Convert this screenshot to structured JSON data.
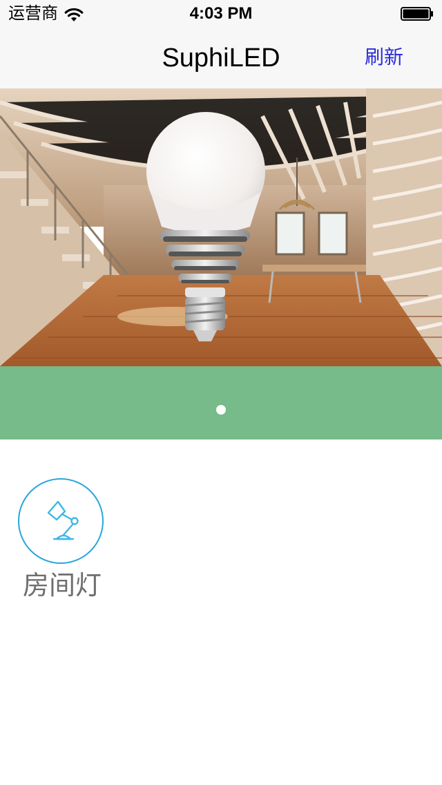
{
  "status_bar": {
    "carrier": "运营商",
    "time": "4:03 PM",
    "wifi_icon": "wifi-icon",
    "battery_icon": "battery-full-icon"
  },
  "nav": {
    "title": "SuphiLED",
    "refresh_label": "刷新"
  },
  "hero": {
    "image": "led-bulb-in-living-room-photo"
  },
  "pager": {
    "page_count": 1,
    "current_page": 1
  },
  "devices": [
    {
      "label": "房间灯",
      "icon": "desk-lamp-icon"
    }
  ],
  "colors": {
    "accent_link": "#2b2bd9",
    "pager_band": "#76bb89",
    "device_ring": "#28a6da",
    "device_label": "#6e6e6e"
  }
}
